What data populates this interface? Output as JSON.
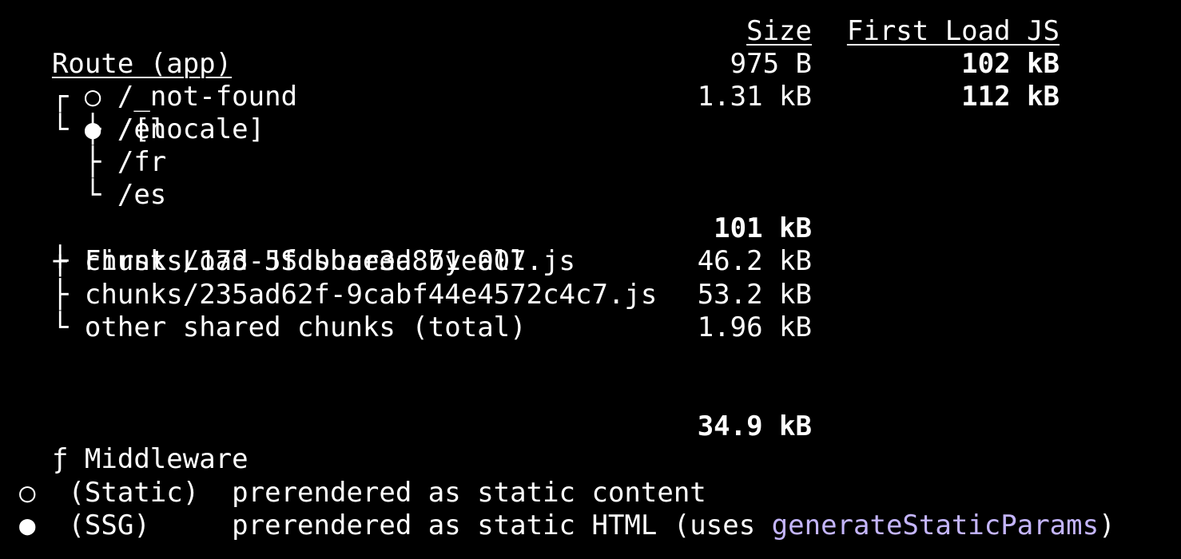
{
  "header": {
    "route_col": "Route (app)",
    "size_col": "Size",
    "first_load_col": "First Load JS"
  },
  "routes": [
    {
      "tree": "┌",
      "icon": "○",
      "path": "/_not-found",
      "size": "975 B",
      "first_load": "102 kB"
    },
    {
      "tree": "└",
      "icon": "●",
      "path": "/[locale]",
      "size": "1.31 kB",
      "first_load": "112 kB"
    }
  ],
  "locale_paths": [
    {
      "tree": "├",
      "path": "/en"
    },
    {
      "tree": "├",
      "path": "/fr"
    },
    {
      "tree": "└",
      "path": "/es"
    }
  ],
  "shared": {
    "prefix": "+",
    "label": "First Load JS shared by all",
    "size": "101 kB",
    "chunks": [
      {
        "tree": "├",
        "name": "chunks/173-5fdbbce3a871e007.js",
        "size": "46.2 kB"
      },
      {
        "tree": "├",
        "name": "chunks/235ad62f-9cabf44e4572c4c7.js",
        "size": "53.2 kB"
      },
      {
        "tree": "└",
        "name": "other shared chunks (total)",
        "size": "1.96 kB"
      }
    ]
  },
  "middleware": {
    "icon": "ƒ",
    "label": "Middleware",
    "size": "34.9 kB"
  },
  "legend": [
    {
      "icon": "○",
      "type": "(Static)",
      "desc": "prerendered as static content",
      "highlight": "",
      "suffix": ""
    },
    {
      "icon": "●",
      "type": "(SSG)",
      "desc": "prerendered as static HTML (uses ",
      "highlight": "generateStaticParams",
      "suffix": ")"
    }
  ],
  "colors": {
    "background": "#000000",
    "text": "#ffffff",
    "accent": "#c4b5fd"
  }
}
